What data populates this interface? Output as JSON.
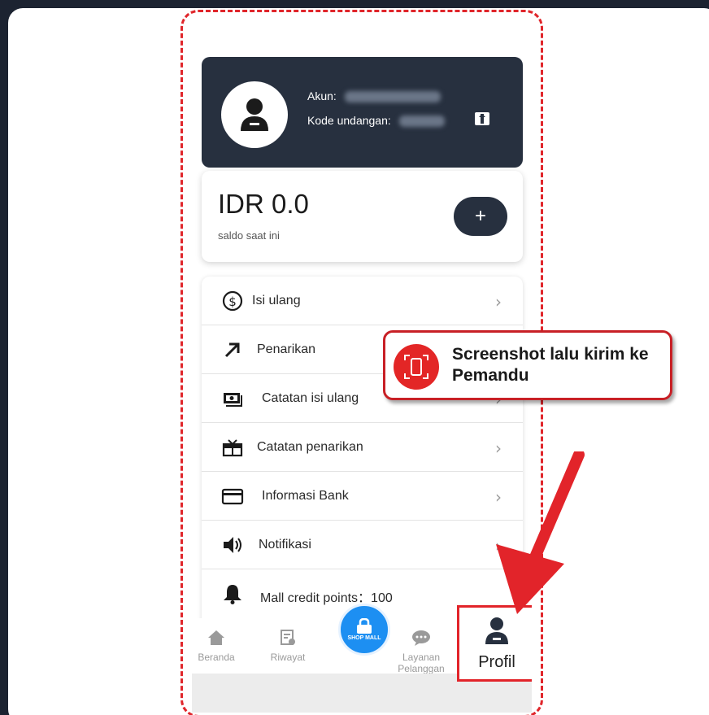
{
  "account": {
    "akun_label": "Akun:",
    "kode_label": "Kode undangan:"
  },
  "balance": {
    "amount": "IDR 0.0",
    "label": "saldo saat ini",
    "add_label": "+"
  },
  "menu": {
    "items": [
      {
        "label": "Isi ulang",
        "icon": "dollar-icon"
      },
      {
        "label": "Penarikan",
        "icon": "arrow-up-right-icon"
      },
      {
        "label": "Catatan isi ulang",
        "icon": "cash-icon"
      },
      {
        "label": "Catatan penarikan",
        "icon": "gift-icon"
      },
      {
        "label": "Informasi Bank",
        "icon": "card-icon"
      },
      {
        "label": "Notifikasi",
        "icon": "speaker-icon"
      },
      {
        "label": "Mall credit points：100",
        "icon": "bell-icon"
      }
    ]
  },
  "nav": {
    "beranda": "Beranda",
    "riwayat": "Riwayat",
    "shop_mall": "SHOP MALL",
    "layanan": "Layanan Pelanggan",
    "profil": "Profil"
  },
  "callout": {
    "text": "Screenshot lalu kirim ke Pemandu"
  },
  "colors": {
    "header_bg": "#27303f",
    "accent_red": "#e2242a",
    "shop_blue": "#1d8ff2"
  }
}
